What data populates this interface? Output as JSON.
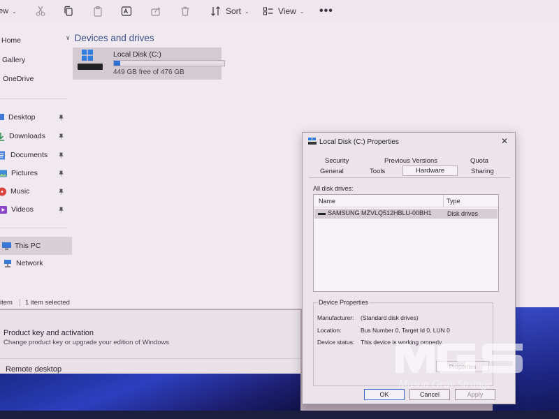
{
  "toolbar": {
    "view_partial": "ew",
    "sort_label": "Sort",
    "view_label": "View",
    "icons": [
      "cut-icon",
      "copy-icon",
      "paste-icon",
      "rename-icon",
      "share-icon",
      "delete-icon",
      "sort-icon",
      "view-icon",
      "more-icon"
    ]
  },
  "sidebar": {
    "items": [
      {
        "label": "Home",
        "icon": "home-icon"
      },
      {
        "label": "Gallery",
        "icon": "gallery-icon"
      },
      {
        "label": "OneDrive",
        "icon": "onedrive-icon"
      },
      {
        "label": "Desktop",
        "icon": "desktop-icon",
        "pinned": true
      },
      {
        "label": "Downloads",
        "icon": "downloads-icon",
        "pinned": true
      },
      {
        "label": "Documents",
        "icon": "documents-icon",
        "pinned": true
      },
      {
        "label": "Pictures",
        "icon": "pictures-icon",
        "pinned": true
      },
      {
        "label": "Music",
        "icon": "music-icon",
        "pinned": true
      },
      {
        "label": "Videos",
        "icon": "videos-icon",
        "pinned": true
      },
      {
        "label": "This PC",
        "icon": "this-pc-icon",
        "selected": true
      },
      {
        "label": "Network",
        "icon": "network-icon"
      }
    ]
  },
  "main": {
    "section_title": "Devices and drives",
    "drive": {
      "name": "Local Disk (C:)",
      "free_text": "449 GB free of 476 GB",
      "used_fraction": 0.057
    }
  },
  "status": {
    "count_text": "item",
    "selected_text": "1 item selected"
  },
  "settings": {
    "product_key_title": "Product key and activation",
    "product_key_sub": "Change product key or upgrade your edition of Windows",
    "remote_desktop": "Remote desktop"
  },
  "dialog": {
    "title": "Local Disk (C:) Properties",
    "close_glyph": "✕",
    "tabs_row1": [
      "Security",
      "Previous Versions",
      "Quota"
    ],
    "tabs_row2": [
      "General",
      "Tools",
      "Hardware",
      "Sharing"
    ],
    "active_tab": "Hardware",
    "all_disk_label": "All disk drives:",
    "columns": [
      "Name",
      "Type"
    ],
    "rows": [
      {
        "name": "SAMSUNG MZVLQ512HBLU-00BH1",
        "type": "Disk drives"
      }
    ],
    "device_properties": {
      "title": "Device Properties",
      "manufacturer_label": "Manufacturer:",
      "manufacturer": "(Standard disk drives)",
      "location_label": "Location:",
      "location": "Bus Number 0, Target Id 0, LUN 0",
      "status_label": "Device status:",
      "status": "This device is working properly.",
      "properties_button": "Properties"
    },
    "buttons": {
      "ok": "OK",
      "cancel": "Cancel",
      "apply": "Apply"
    }
  },
  "watermark": {
    "text": "Mason Gray Strange"
  },
  "colors": {
    "accent": "#2a6fd1",
    "wallpaper": "#2d3fbf"
  }
}
